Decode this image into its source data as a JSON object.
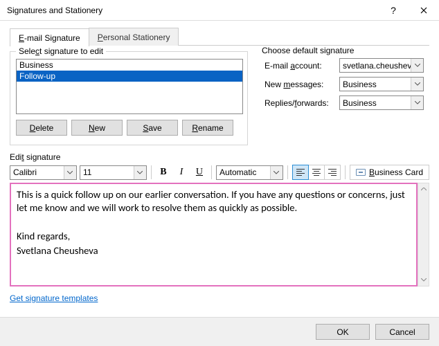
{
  "title": "Signatures and Stationery",
  "tabs": {
    "active": "E-mail Signature",
    "inactive": "Personal Stationery"
  },
  "select_group": {
    "legend": "Select signature to edit",
    "items": [
      "Business",
      "Follow-up"
    ],
    "selected_index": 1
  },
  "buttons": {
    "delete": "Delete",
    "new": "New",
    "save": "Save",
    "rename": "Rename"
  },
  "default_group": {
    "legend": "Choose default signature",
    "account_label": "E-mail account:",
    "account_value": "svetlana.cheusheva",
    "newmsg_label": "New messages:",
    "newmsg_value": "Business",
    "replies_label": "Replies/forwards:",
    "replies_value": "Business"
  },
  "edit_group": {
    "legend": "Edit signature",
    "font": "Calibri",
    "size": "11",
    "color": "Automatic",
    "business_card": "Business Card"
  },
  "editor_lines": [
    "This is a quick follow up on our earlier conversation. If you have any questions or concerns, just let me know and we will work to resolve them as quickly as possible.",
    "",
    "Kind regards,",
    "Svetlana Cheusheva"
  ],
  "link": "Get signature templates",
  "footer": {
    "ok": "OK",
    "cancel": "Cancel"
  }
}
